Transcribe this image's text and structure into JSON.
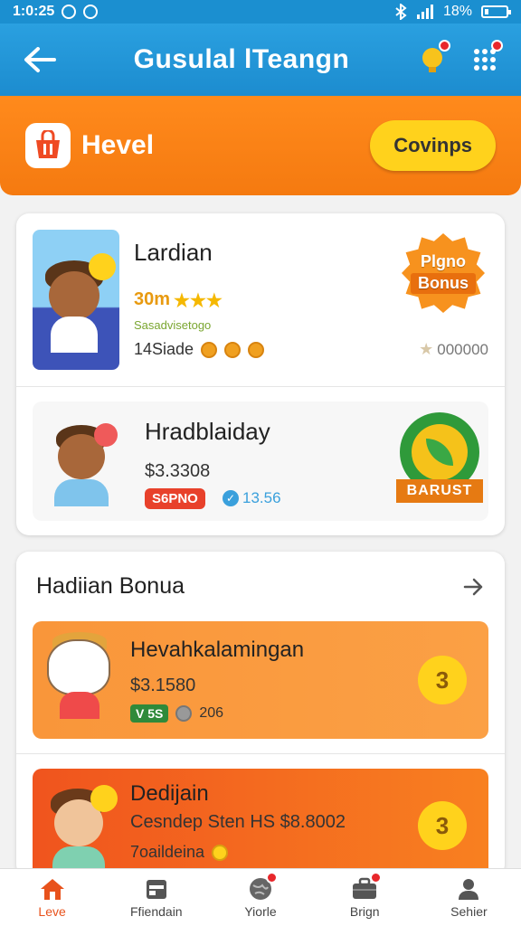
{
  "status_bar": {
    "time": "1:0:25",
    "battery": "18%",
    "battery_level": 0.18
  },
  "app_bar": {
    "title": "Gusulal lTeangn"
  },
  "banner": {
    "title": "Hevel",
    "button_label": "Covinps"
  },
  "top_card": {
    "item1": {
      "title": "Lardian",
      "amount": "30m",
      "rating": "★★★",
      "tagline": "Sasadvisetogo",
      "meta": "14Siade",
      "badge_line1": "Plgno",
      "badge_line2": "Bonus",
      "points": "000000"
    },
    "item2": {
      "title": "Hradblaiday",
      "amount": "$3.3308",
      "pill": "S6PNO",
      "stat": "13.56",
      "badge_label": "BARUST"
    }
  },
  "bonus_section": {
    "title": "Hadiian Bonua",
    "items": [
      {
        "title": "Hevahkalamingan",
        "amount": "$3.1580",
        "pill": "V 5S",
        "meta": "206",
        "number": "3"
      },
      {
        "title": "Dedijain",
        "amount": "Cesndep Sten HS $8.8002",
        "meta": "7oaildeina",
        "number": "3"
      }
    ]
  },
  "bottom_nav": [
    {
      "label": "Leve",
      "icon": "home-icon",
      "active": true
    },
    {
      "label": "Ffiendain",
      "icon": "calendar-icon",
      "active": false
    },
    {
      "label": "Yiorle",
      "icon": "globe-icon",
      "active": false
    },
    {
      "label": "Brign",
      "icon": "briefcase-icon",
      "active": false
    },
    {
      "label": "Sehier",
      "icon": "person-icon",
      "active": false
    }
  ]
}
